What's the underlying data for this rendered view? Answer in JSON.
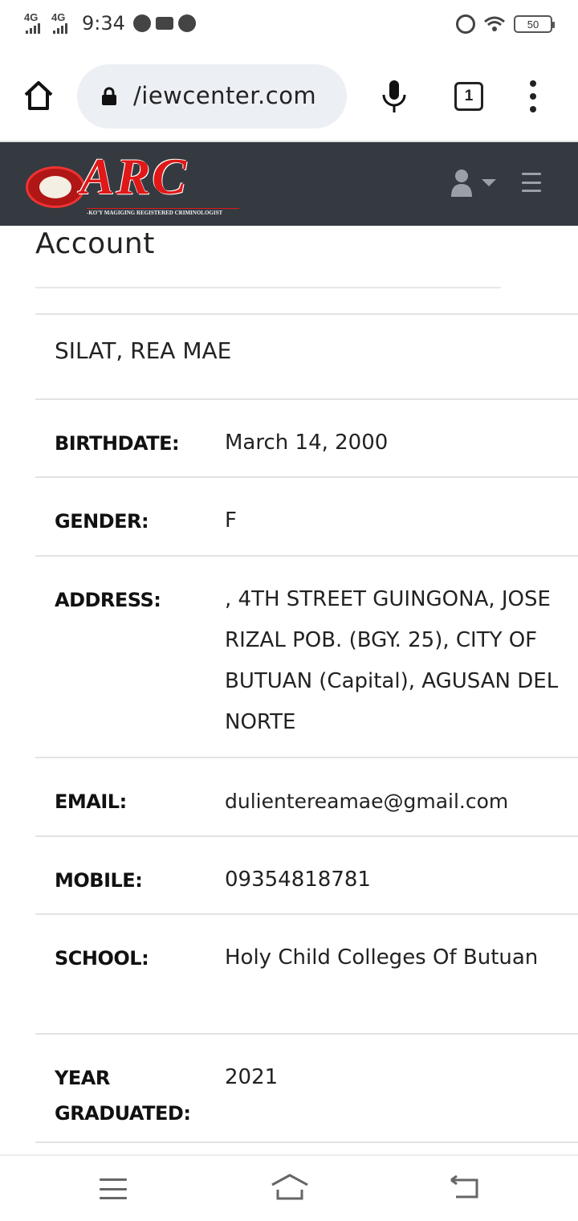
{
  "status_bar": {
    "network_1": "4G",
    "network_2": "4G",
    "time": "9:34",
    "battery_level": "50",
    "icons": [
      "signal-icon",
      "messenger-icon",
      "mail-icon",
      "alarm-icon",
      "wifi-icon",
      "battery-icon"
    ]
  },
  "browser": {
    "url": "/iewcenter.com",
    "tab_count": "1",
    "icons": [
      "home-icon",
      "lock-icon",
      "mic-icon",
      "tabs-icon",
      "more-icon"
    ]
  },
  "site_header": {
    "logo_text": "ARC",
    "logo_tagline": "-KO'Y MAGIGING REGISTERED CRIMINOLOGIST",
    "colors": {
      "header_bg": "#343a40",
      "logo_red": "#e01818"
    }
  },
  "page": {
    "title": "Account"
  },
  "profile": {
    "name": "SILAT, REA MAE",
    "fields": [
      {
        "label": "BIRTHDATE:",
        "value": "March 14, 2000"
      },
      {
        "label": "GENDER:",
        "value": "F"
      },
      {
        "label": "ADDRESS:",
        "value": ", 4TH STREET GUINGONA, JOSE RIZAL POB. (BGY. 25), CITY OF BUTUAN (Capital), AGUSAN DEL NORTE"
      },
      {
        "label": "EMAIL:",
        "value": "dulientereamae@gmail.com"
      },
      {
        "label": "MOBILE:",
        "value": "09354818781"
      },
      {
        "label": "SCHOOL:",
        "value": "Holy Child Colleges Of Butuan"
      },
      {
        "label": "YEAR GRADUATED:",
        "value": "2021"
      }
    ]
  },
  "nav_bar": {
    "icons": [
      "menu-icon",
      "home-icon",
      "back-icon"
    ]
  }
}
